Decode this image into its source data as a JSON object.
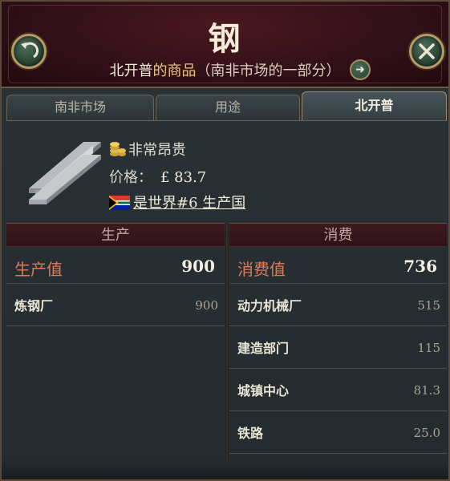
{
  "header": {
    "title": "钢",
    "subtitle_owner": "北开普",
    "subtitle_mid": "的商品",
    "subtitle_paren": "（南非市场的一部分）"
  },
  "tabs": [
    {
      "label": "南非市场",
      "active": false
    },
    {
      "label": "用途",
      "active": false
    },
    {
      "label": "北开普",
      "active": true
    }
  ],
  "info": {
    "price_level": "非常昂贵",
    "price_label": "价格：",
    "price_value": "£ 83.7",
    "rank_text": "是世界#6 生产国"
  },
  "production": {
    "header": "生产",
    "total_label": "生产值",
    "total_value": "900",
    "rows": [
      {
        "name": "炼钢厂",
        "value": "900"
      }
    ]
  },
  "consumption": {
    "header": "消费",
    "total_label": "消费值",
    "total_value": "736",
    "rows": [
      {
        "name": "动力机械厂",
        "value": "515"
      },
      {
        "name": "建造部门",
        "value": "115"
      },
      {
        "name": "城镇中心",
        "value": "81.3"
      },
      {
        "name": "铁路",
        "value": "25.0"
      }
    ]
  },
  "icons": {
    "back": "back-arrow-icon",
    "close": "close-icon",
    "go": "arrow-right-icon",
    "goods": "steel-beam-icon",
    "coins": "gold-coins-icon",
    "flag": "south-africa-flag-icon"
  },
  "colors": {
    "header_bg": "#3a1119",
    "accent_gold": "#e8c878",
    "total_label": "#e07a58",
    "button_green": "#2a4636"
  }
}
